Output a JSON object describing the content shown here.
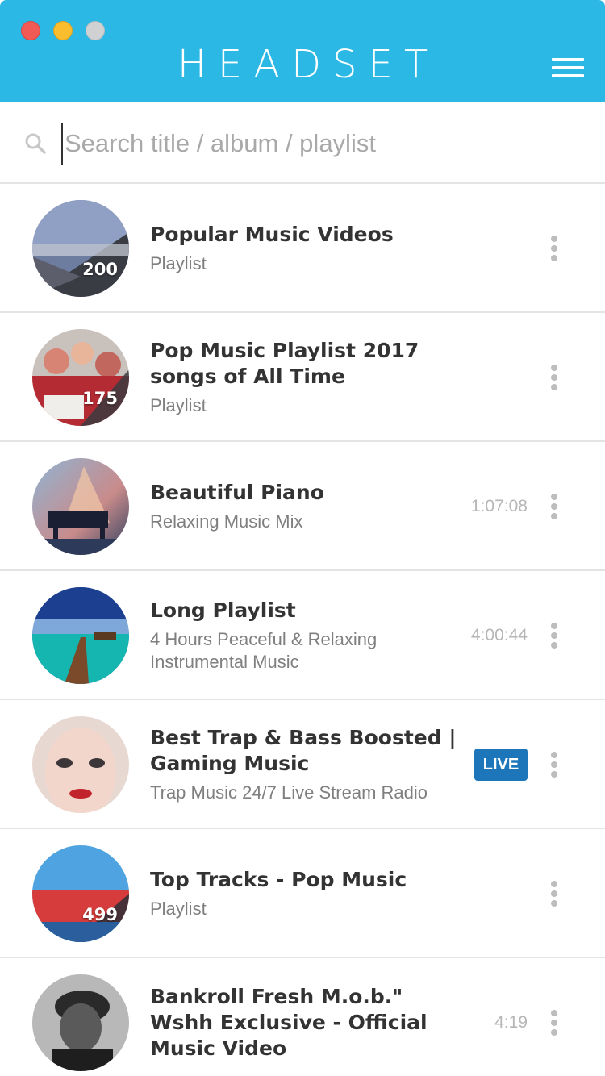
{
  "app": {
    "title": "HEADSET"
  },
  "search": {
    "placeholder": "Search title / album / playlist",
    "value": ""
  },
  "items": [
    {
      "title": "Popular Music Videos",
      "subtitle": "Playlist",
      "count": "200",
      "duration": "",
      "live": ""
    },
    {
      "title": "Pop Music Playlist 2017 songs of All Time",
      "subtitle": "Playlist",
      "count": "175",
      "duration": "",
      "live": ""
    },
    {
      "title": "Beautiful Piano",
      "subtitle": "Relaxing Music Mix",
      "count": "",
      "duration": "1:07:08",
      "live": ""
    },
    {
      "title": "Long Playlist",
      "subtitle": "4 Hours Peaceful & Relaxing Instrumental Music",
      "count": "",
      "duration": "4:00:44",
      "live": ""
    },
    {
      "title": "Best Trap & Bass Boosted | Gaming Music",
      "subtitle": "Trap Music 24/7 Live Stream Radio",
      "count": "",
      "duration": "",
      "live": "LIVE"
    },
    {
      "title": "Top Tracks - Pop Music",
      "subtitle": "Playlist",
      "count": "499",
      "duration": "",
      "live": ""
    },
    {
      "title": "Bankroll Fresh M.o.b.\" Wshh Exclusive - Official Music Video",
      "subtitle": "",
      "count": "",
      "duration": "4:19",
      "live": ""
    }
  ],
  "colors": {
    "accent": "#2cb8e4",
    "live_badge": "#1d76b9"
  }
}
